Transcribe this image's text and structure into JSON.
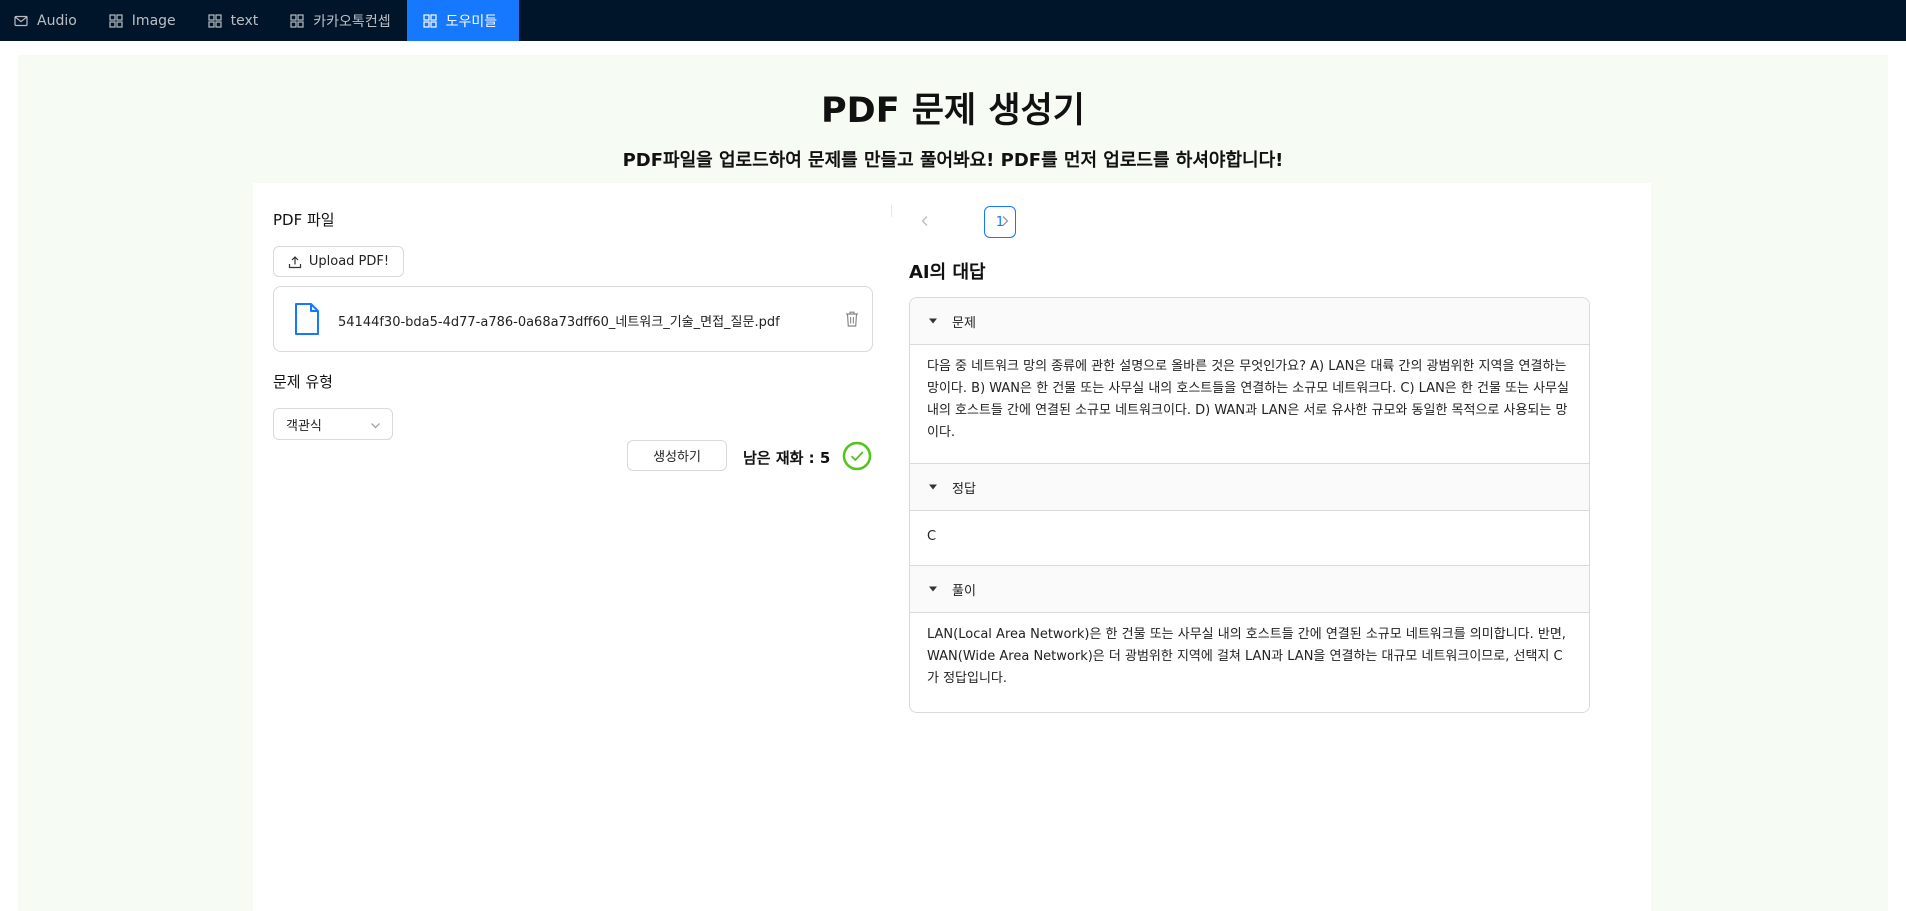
{
  "nav": {
    "items": [
      {
        "label": "Audio",
        "icon": "mail-icon"
      },
      {
        "label": "Image",
        "icon": "appstore-icon"
      },
      {
        "label": "text",
        "icon": "appstore-icon"
      },
      {
        "label": "카카오톡컨셉",
        "icon": "appstore-icon"
      },
      {
        "label": "도우미들",
        "icon": "appstore-icon",
        "active": true
      }
    ]
  },
  "page": {
    "title": "PDF 문제 생성기",
    "subtitle": "PDF파일을 업로드하여 문제를 만들고 풀어봐요! PDF를 먼저 업로드를 하셔야합니다!"
  },
  "left": {
    "pdf_label": "PDF 파일",
    "upload_button": "Upload PDF!",
    "file_name": "54144f30-bda5-4d77-a786-0a68a73dff60_네트워크_기술_면접_질문.pdf",
    "type_label": "문제 유형",
    "type_selected": "객관식",
    "generate_button": "생성하기",
    "remaining": "남은 재화 : 5"
  },
  "right": {
    "pagination": {
      "current": "1"
    },
    "ai_title": "AI의 대답",
    "panels": [
      {
        "header": "문제",
        "body": "다음 중 네트워크 망의 종류에 관한 설명으로 올바른 것은 무엇인가요? A) LAN은 대륙 간의 광범위한 지역을 연결하는 망이다. B) WAN은 한 건물 또는 사무실 내의 호스트들을 연결하는 소규모 네트워크다. C) LAN은 한 건물 또는 사무실 내의 호스트들 간에 연결된 소규모 네트워크이다. D) WAN과 LAN은 서로 유사한 규모와 동일한 목적으로 사용되는 망이다."
      },
      {
        "header": "정답",
        "body": "C"
      },
      {
        "header": "풀이",
        "body": "LAN(Local Area Network)은 한 건물 또는 사무실 내의 호스트들 간에 연결된 소규모 네트워크를 의미합니다. 반면, WAN(Wide Area Network)은 더 광범위한 지역에 걸쳐 LAN과 LAN을 연결하는 대규모 네트워크이므로, 선택지 C가 정답입니다."
      }
    ]
  },
  "colors": {
    "nav_bg": "#001529",
    "accent": "#1677ff",
    "page_bg": "#f6fcf3",
    "success": "#52c41a"
  }
}
